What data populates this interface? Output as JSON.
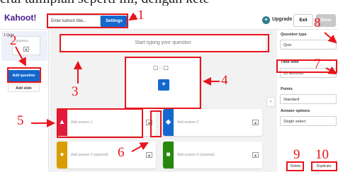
{
  "caption_fragment": "eral taimplan seperti ini, dengan kete",
  "header": {
    "logo": "Kahoot!",
    "title_placeholder": "Enter kahoot title...",
    "settings_label": "Settings",
    "upgrade_label": "Upgrade",
    "exit_label": "Exit",
    "done_label": "Done"
  },
  "sidebar": {
    "slide_label": "1 Quiz",
    "thumb_text": "Question",
    "add_question_label": "Add question",
    "add_slide_label": "Add slide"
  },
  "editor": {
    "question_placeholder": "Start typing your question",
    "answers": [
      {
        "label": "Add answer 1",
        "color": "#e21b3c",
        "shape": "triangle"
      },
      {
        "label": "Add answer 2",
        "color": "#1368ce",
        "shape": "diamond"
      },
      {
        "label": "Add answer 3 (optional)",
        "color": "#d89e00",
        "shape": "circle"
      },
      {
        "label": "Add answer 4 (optional)",
        "color": "#26890c",
        "shape": "square"
      }
    ]
  },
  "settings_panel": {
    "question_type_label": "Question type",
    "question_type_value": "Quiz",
    "time_limit_label": "Time limit",
    "time_limit_value": "20 seconds",
    "points_label": "Points",
    "points_value": "Standard",
    "answer_options_label": "Answer options",
    "answer_options_value": "Single select",
    "delete_label": "Delete",
    "duplicate_label": "Duplicate"
  },
  "annotations": [
    "1",
    "2",
    "3",
    "4",
    "5",
    "6",
    "7",
    "8",
    "9",
    "10"
  ],
  "accent_color": "#e8141b"
}
